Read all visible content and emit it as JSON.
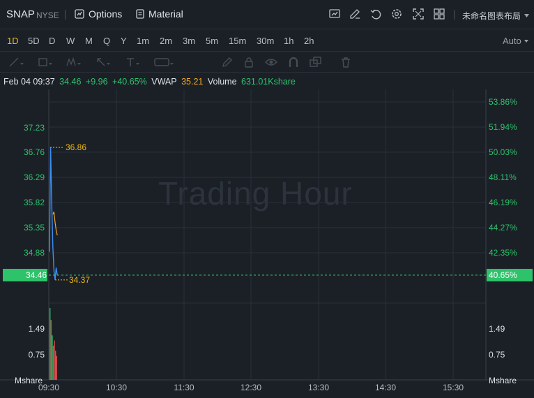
{
  "header": {
    "symbol": "SNAP",
    "exchange": "NYSE",
    "options_label": "Options",
    "material_label": "Material",
    "layout_label": "未命名图表布局",
    "icons": [
      "chart-type-icon",
      "edit-icon",
      "undo-icon",
      "settings-icon",
      "fullscreen-icon",
      "layout-grid-icon"
    ]
  },
  "periods": [
    "1D",
    "5D",
    "D",
    "W",
    "M",
    "Q",
    "Y",
    "1m",
    "2m",
    "3m",
    "5m",
    "15m",
    "30m",
    "1h",
    "2h"
  ],
  "active_period": "1D",
  "scale_mode": "Auto",
  "drawing_tools": [
    "trend-line-icon",
    "rectangle-icon",
    "pattern-icon",
    "arrow-icon",
    "text-icon",
    "price-label-icon",
    "pencil-icon",
    "lock-icon",
    "eye-icon",
    "magnet-icon",
    "layers-icon",
    "trash-icon"
  ],
  "info": {
    "datetime": "Feb 04 09:37",
    "price": "34.46",
    "change": "+9.96",
    "change_pct": "+40.65%",
    "vwap_label": "VWAP",
    "vwap_value": "35.21",
    "volume_label": "Volume",
    "volume_value": "631.01Kshare"
  },
  "watermark": "Trading Hour",
  "chart_data": {
    "type": "line",
    "x_ticks": [
      "09:30",
      "10:30",
      "11:30",
      "12:30",
      "13:30",
      "14:30",
      "15:30"
    ],
    "price_ticks_left": [
      "37.23",
      "36.76",
      "36.29",
      "35.82",
      "35.35",
      "34.88"
    ],
    "pct_ticks_right": [
      "53.86%",
      "51.94%",
      "50.03%",
      "48.11%",
      "46.19%",
      "44.27%",
      "42.35%"
    ],
    "current_price": "34.46",
    "current_pct": "40.65%",
    "high_marker": "36.86",
    "low_marker": "34.37",
    "volume_ticks": [
      "1.49",
      "0.75"
    ],
    "volume_unit": "Mshare",
    "price_series": {
      "name": "Price",
      "color": "#3d8ff5",
      "points": [
        [
          0,
          34.9
        ],
        [
          1,
          36.86
        ],
        [
          2,
          35.8
        ],
        [
          3,
          35.0
        ],
        [
          4,
          34.55
        ],
        [
          5,
          34.37
        ],
        [
          6,
          34.6
        ],
        [
          7,
          34.46
        ]
      ]
    },
    "vwap_series": {
      "name": "VWAP",
      "color": "#f5a623",
      "points": [
        [
          3,
          35.6
        ],
        [
          4,
          35.65
        ],
        [
          5,
          35.45
        ],
        [
          6,
          35.3
        ],
        [
          7,
          35.21
        ]
      ]
    },
    "volume_bars": [
      {
        "v": 2.1,
        "color": "#2ec26a"
      },
      {
        "v": 1.75,
        "color": "#e04a4a"
      },
      {
        "v": 1.3,
        "color": "#2ec26a"
      },
      {
        "v": 1.0,
        "color": "#e04a4a"
      },
      {
        "v": 1.15,
        "color": "#e04a4a"
      },
      {
        "v": 0.85,
        "color": "#e04a4a"
      },
      {
        "v": 0.7,
        "color": "#e04a4a"
      }
    ],
    "colors": {
      "up": "#2ec26a",
      "down": "#e04a4a",
      "marker": "#f0b90b",
      "grid": "#2a3038"
    }
  }
}
